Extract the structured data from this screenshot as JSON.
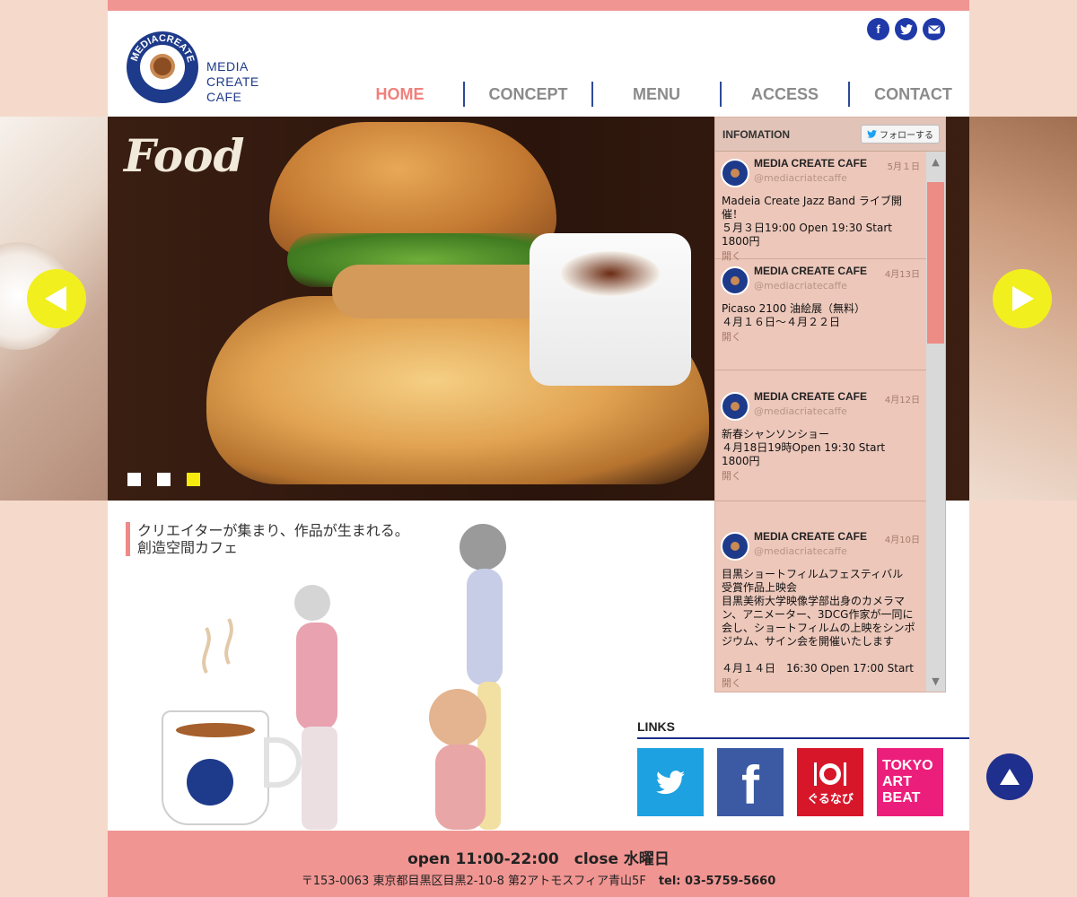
{
  "brand": {
    "logo_lines": [
      "MEDIA",
      "CREATE",
      "CAFE"
    ],
    "logo_ring_text": "MEDIACREATE CAFE"
  },
  "social": [
    "facebook-icon",
    "twitter-icon",
    "mail-icon"
  ],
  "nav": [
    "HOME",
    "CONCEPT",
    "MENU",
    "ACCESS",
    "CONTACT"
  ],
  "slider": {
    "title": "Food",
    "active_dot": 3,
    "dot_count": 3
  },
  "info": {
    "header": "INFOMATION",
    "follow_label": "フォローする",
    "tweets": [
      {
        "name": "MEDIA CREATE CAFE",
        "handle": "@mediacriatecaffe",
        "date": "5月１日",
        "body": "Madeia Create Jazz Band ライブ開催！\n５月３日19:00 Open 19:30 Start\n1800円",
        "open": "開く"
      },
      {
        "name": "MEDIA CREATE CAFE",
        "handle": "@mediacriatecaffe",
        "date": "4月13日",
        "body": "Picaso 2100 油絵展（無料）\n４月１６日〜４月２２日",
        "open": "開く"
      },
      {
        "name": "MEDIA CREATE CAFE",
        "handle": "@mediacriatecaffe",
        "date": "4月12日",
        "body": "新春シャンソンショー\n４月18日19時Open 19:30 Start\n1800円",
        "open": "開く"
      },
      {
        "name": "MEDIA CREATE CAFE",
        "handle": "@mediacriatecaffe",
        "date": "4月10日",
        "body": "目黒ショートフィルムフェスティバル\n受賞作品上映会\n目黒美術大学映像学部出身のカメラマン、アニメーター、3DCG作家が一同に会し、ショートフィルムの上映をシンポジウム、サイン会を開催いたします\n\n４月１４日　16:30 Open 17:00 Start",
        "open": "開く"
      }
    ]
  },
  "tagline": [
    "クリエイターが集まり、作品が生まれる。",
    "創造空間カフェ"
  ],
  "links": {
    "title": "LINKS",
    "items": [
      {
        "name": "twitter",
        "label": "",
        "color": "#1da1e0"
      },
      {
        "name": "facebook",
        "label": "f",
        "color": "#3b5aa3"
      },
      {
        "name": "gurunavi",
        "label": "ぐるなび",
        "color": "#d7162a"
      },
      {
        "name": "tokyo-art-beat",
        "label": "TOKYO ART BEAT",
        "color": "#ec1e7c"
      }
    ]
  },
  "footer": {
    "hours": "open 11:00-22:00　close 水曜日",
    "address": "〒153-0063  東京都目黒区目黒2-10-8  第2アトモスフィア青山5F",
    "tel": "tel: 03-5759-5660"
  },
  "colors": {
    "accent_pink": "#f09592",
    "brand_navy": "#1e3a8a",
    "slider_arrow": "#f2ef1e",
    "active_dot": "#f6ea0f"
  }
}
